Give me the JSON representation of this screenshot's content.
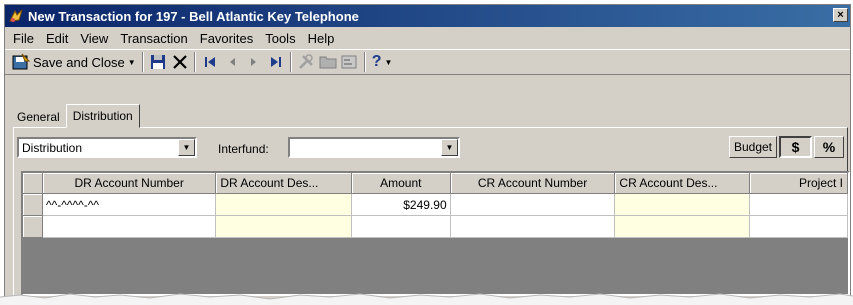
{
  "window": {
    "title": "New Transaction for 197 - Bell Atlantic Key Telephone",
    "close": "×"
  },
  "menu": [
    "File",
    "Edit",
    "View",
    "Transaction",
    "Favorites",
    "Tools",
    "Help"
  ],
  "toolbar": {
    "save_close": "Save and Close",
    "help_glyph": "?"
  },
  "tabs": {
    "general": "General",
    "distribution": "Distribution"
  },
  "filters": {
    "distribution_value": "Distribution",
    "interfund_label": "Interfund:",
    "interfund_value": "",
    "budget_label": "Budget",
    "dollar_label": "$",
    "percent_label": "%"
  },
  "grid": {
    "columns": [
      "DR Account Number",
      "DR Account Des...",
      "Amount",
      "CR Account Number",
      "CR Account Des...",
      "Project I"
    ],
    "rows": [
      {
        "dr_account": "^^-^^^^-^^",
        "dr_desc": "",
        "amount": "$249.90",
        "cr_account": "",
        "cr_desc": "",
        "project": ""
      },
      {
        "dr_account": "",
        "dr_desc": "",
        "amount": "",
        "cr_account": "",
        "cr_desc": "",
        "project": ""
      }
    ]
  }
}
